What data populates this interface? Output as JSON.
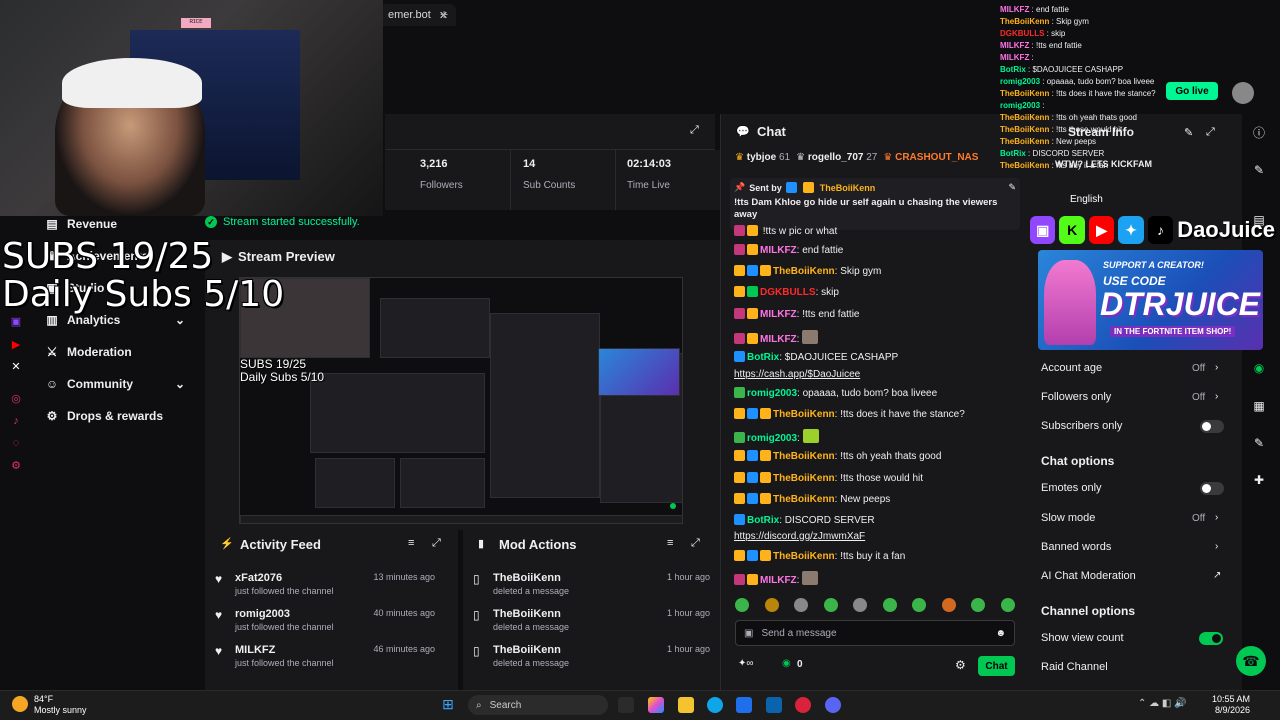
{
  "browser": {
    "tab_title": "emer.bot",
    "close": "✕",
    "new_tab": "+"
  },
  "stats": [
    {
      "value": "3,216",
      "label": "Followers"
    },
    {
      "value": "14",
      "label": "Sub Counts"
    },
    {
      "value": "02:14:03",
      "label": "Time Live"
    }
  ],
  "toast": "Stream started successfully.",
  "webcam": {
    "sign_text": "ʀɪᴄᴇ"
  },
  "overlay": {
    "subs_line": "SUBS 19/25",
    "daily_line": "Daily Subs  5/10"
  },
  "nav": {
    "items": [
      {
        "label": "Revenue",
        "icon": "revenue-icon"
      },
      {
        "label": "Achievements",
        "icon": "trophy-icon"
      },
      {
        "label": "Studio",
        "icon": "studio-icon"
      },
      {
        "label": "Analytics",
        "icon": "analytics-icon",
        "expand": "⌄"
      },
      {
        "label": "Moderation",
        "icon": "sword-icon"
      },
      {
        "label": "Community",
        "icon": "community-icon",
        "expand": "⌄"
      },
      {
        "label": "Drops & rewards",
        "icon": "gift-icon"
      }
    ]
  },
  "preview": {
    "title": "Stream Preview",
    "mini_subs": "SUBS 19/25",
    "mini_daily": "Daily Subs  5/10"
  },
  "activity_feed": {
    "title": "Activity Feed",
    "rows": [
      {
        "name": "xFat2076",
        "action": "just followed the channel",
        "time": "13 minutes ago"
      },
      {
        "name": "romig2003",
        "action": "just followed the channel",
        "time": "40 minutes ago"
      },
      {
        "name": "MILKFZ",
        "action": "just followed the channel",
        "time": "46 minutes ago"
      }
    ]
  },
  "mod_actions": {
    "title": "Mod Actions",
    "rows": [
      {
        "name": "TheBoiiKenn",
        "action": "deleted a message",
        "time": "1 hour ago"
      },
      {
        "name": "TheBoiiKenn",
        "action": "deleted a message",
        "time": "1 hour ago"
      },
      {
        "name": "TheBoiiKenn",
        "action": "deleted a message",
        "time": "1 hour ago"
      }
    ]
  },
  "chat": {
    "title": "Chat",
    "leaderboard": [
      {
        "name": "tybjoe",
        "count": "61"
      },
      {
        "name": "rogello_707",
        "count": "27"
      },
      {
        "name": "CRASHOUT_NAS",
        "count": ""
      }
    ],
    "pinned": {
      "sent_by": "Sent by",
      "author": "TheBoiiKenn",
      "text": "!tts Dam Khloe go hide ur self again u chasing the viewers away"
    },
    "partial_line": "!tts w pic or what",
    "messages": [
      {
        "name": "MILKFZ",
        "color": "#ff75e6",
        "text": "end fattie"
      },
      {
        "name": "TheBoiiKenn",
        "color": "#ffb31a",
        "text": "Skip gym"
      },
      {
        "name": "DGKBULLS",
        "color": "#ff2a2a",
        "text": "skip"
      },
      {
        "name": "MILKFZ",
        "color": "#ff75e6",
        "text": "!tts end fattie"
      },
      {
        "name": "MILKFZ",
        "color": "#ff75e6",
        "text": ""
      },
      {
        "name": "BotRix",
        "color": "#00f593",
        "text": "$DAOJUICEE CASHAPP"
      },
      {
        "name": "",
        "color": "#efeff1",
        "text": "https://cash.app/$DaoJuicee"
      },
      {
        "name": "romig2003",
        "color": "#00f593",
        "text": "opaaaa, tudo bom? boa liveee"
      },
      {
        "name": "TheBoiiKenn",
        "color": "#ffb31a",
        "text": "!tts does it have the stance?"
      },
      {
        "name": "romig2003",
        "color": "#00f593",
        "text": ""
      },
      {
        "name": "TheBoiiKenn",
        "color": "#ffb31a",
        "text": "!tts oh yeah thats good"
      },
      {
        "name": "TheBoiiKenn",
        "color": "#ffb31a",
        "text": "!tts those would hit"
      },
      {
        "name": "TheBoiiKenn",
        "color": "#ffb31a",
        "text": "New peeps"
      },
      {
        "name": "BotRix",
        "color": "#00f593",
        "text": "DISCORD SERVER"
      },
      {
        "name": "",
        "color": "#efeff1",
        "text": "https://discord.gg/zJmwmXaF"
      },
      {
        "name": "TheBoiiKenn",
        "color": "#ffb31a",
        "text": "!tts buy it a fan"
      },
      {
        "name": "MILKFZ",
        "color": "#ff75e6",
        "text": ""
      }
    ],
    "input_placeholder": "Send a message",
    "points": "0",
    "send_label": "Chat"
  },
  "overlay_chat": [
    {
      "name": "MILKFZ",
      "text": "end fattie",
      "color": "#ff75e6"
    },
    {
      "name": "TheBoiiKenn",
      "text": "Skip gym",
      "color": "#ffb31a"
    },
    {
      "name": "DGKBULLS",
      "text": "skip",
      "color": "#ff2a2a"
    },
    {
      "name": "MILKFZ",
      "text": "!tts end fattie",
      "color": "#ff75e6"
    },
    {
      "name": "MILKFZ",
      "text": "",
      "color": "#ff75e6"
    },
    {
      "name": "BotRix",
      "text": "$DAOJUICEE CASHAPP",
      "color": "#00f593"
    },
    {
      "name": "romig2003",
      "text": "opaaaa, tudo bom? boa liveee",
      "color": "#00f593"
    },
    {
      "name": "TheBoiiKenn",
      "text": "!tts does it have the stance?",
      "color": "#ffb31a"
    },
    {
      "name": "romig2003",
      "text": "",
      "color": "#00f593"
    },
    {
      "name": "TheBoiiKenn",
      "text": "!tts oh yeah thats good",
      "color": "#ffb31a"
    },
    {
      "name": "TheBoiiKenn",
      "text": "!tts those would hit",
      "color": "#ffb31a"
    },
    {
      "name": "TheBoiiKenn",
      "text": "New peeps",
      "color": "#ffb31a"
    },
    {
      "name": "BotRix",
      "text": "DISCORD SERVER",
      "color": "#00f593"
    },
    {
      "name": "TheBoiiKenn",
      "text": "!tts buy it a fan",
      "color": "#ffb31a"
    }
  ],
  "stream_info": {
    "title": "Stream Info",
    "go_live": "Go live",
    "title_text": "WTW? LETS KICKFAM",
    "language": "English"
  },
  "banner": {
    "name": "DaoJuice",
    "support": "SUPPORT A CREATOR!",
    "use_code": "USE CODE",
    "code": "DTRJUICE",
    "item_shop": "IN THE FORTNITE ITEM SHOP!"
  },
  "settings": {
    "account_age": {
      "label": "Account age",
      "value": "Off"
    },
    "followers_only": {
      "label": "Followers only",
      "value": "Off"
    },
    "subscribers_only": {
      "label": "Subscribers only",
      "on": false
    },
    "chat_options": "Chat options",
    "emotes_only": {
      "label": "Emotes only",
      "on": false
    },
    "slow_mode": {
      "label": "Slow mode",
      "value": "Off"
    },
    "banned_words": {
      "label": "Banned words"
    },
    "ai_moderation": {
      "label": "AI Chat Moderation"
    },
    "channel_options": "Channel options",
    "show_view_count": {
      "label": "Show view count",
      "on": true
    },
    "raid_channel": {
      "label": "Raid Channel"
    }
  },
  "taskbar": {
    "weather_temp": "84°F",
    "weather_desc": "Mostly sunny",
    "search_placeholder": "Search",
    "time": "10:55 AM",
    "date": "8/9/2026"
  },
  "colors": {
    "accent": "#00c853",
    "bg": "#0e0e10",
    "panel": "#18181b"
  }
}
